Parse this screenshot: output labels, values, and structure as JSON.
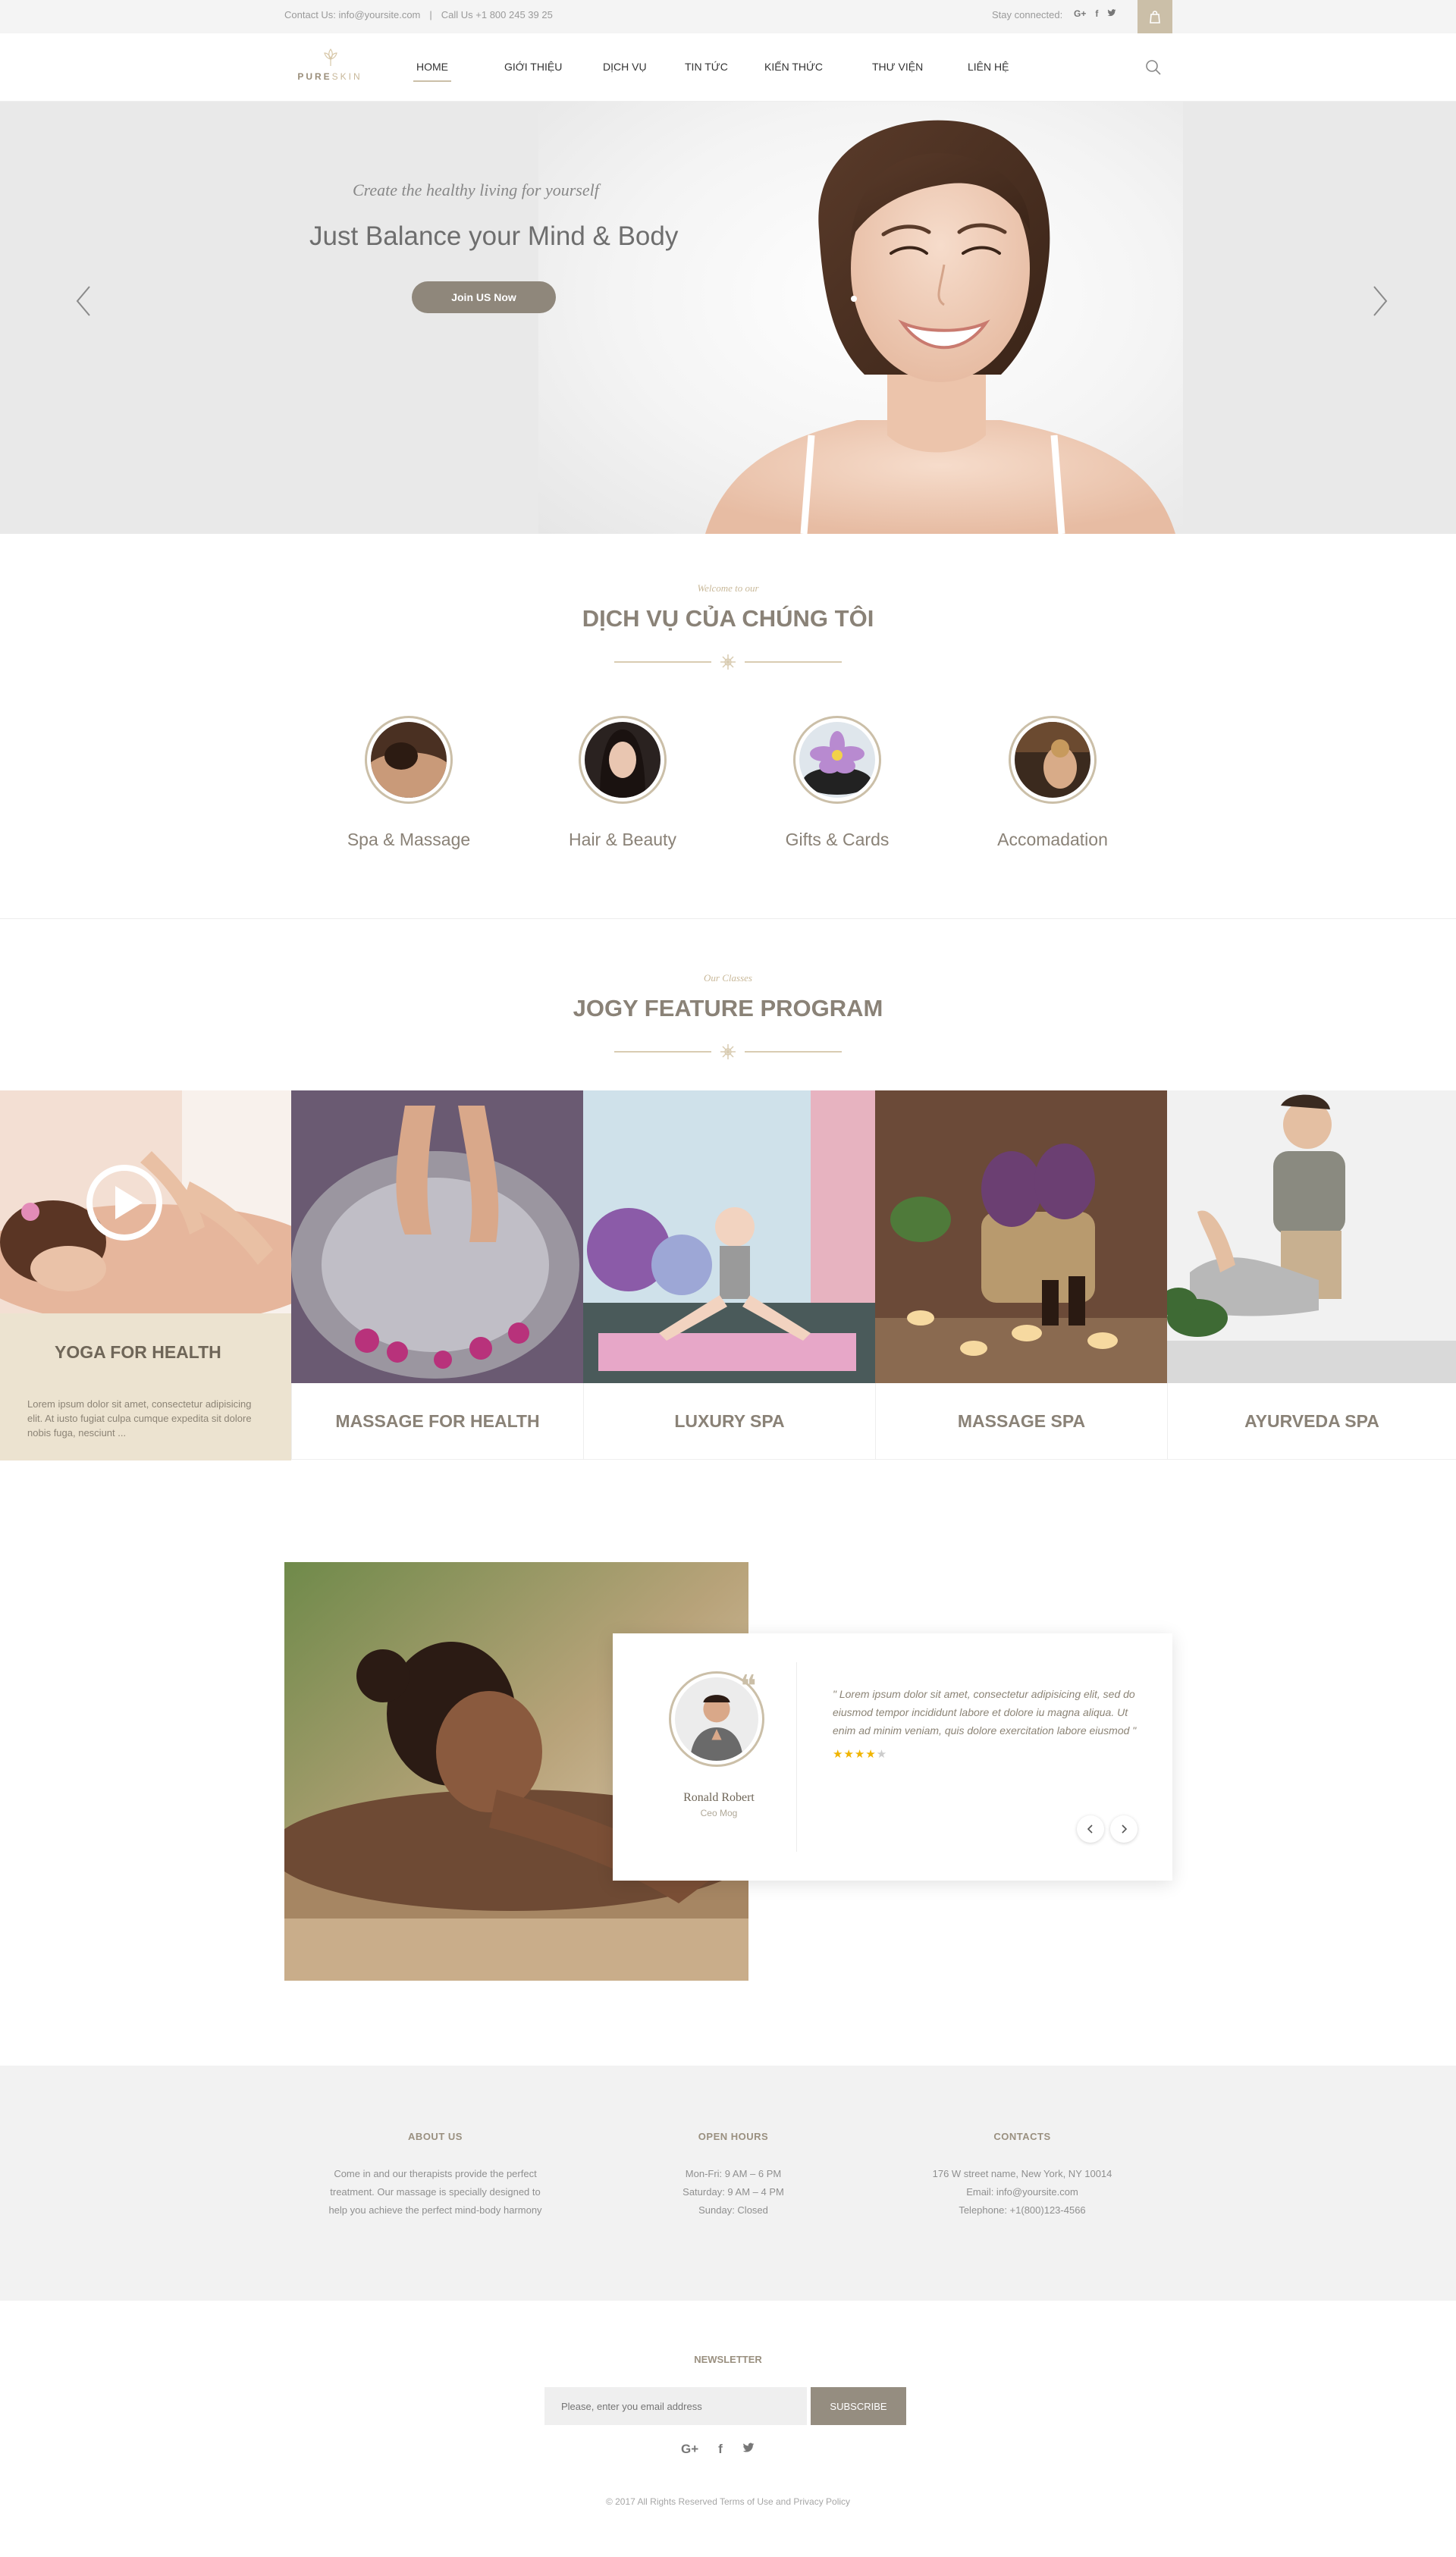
{
  "topbar": {
    "contact": "Contact Us: info@yoursite.com",
    "call": "Call Us +1 800 245 39 25",
    "stay_connected": "Stay connected:",
    "social_icons": [
      "google-plus-icon",
      "facebook-icon",
      "twitter-icon"
    ],
    "cart_icon": "bag-icon"
  },
  "logo": {
    "brand_a": "PURE",
    "brand_b": "SKIN"
  },
  "nav": {
    "items": [
      {
        "label": "HOME",
        "active": true
      },
      {
        "label": "GIỚI THIỆU"
      },
      {
        "label": "DỊCH VỤ"
      },
      {
        "label": "TIN TỨC"
      },
      {
        "label": "KIẾN THỨC"
      },
      {
        "label": "THƯ VIỆN"
      },
      {
        "label": "LIÊN HỆ"
      }
    ],
    "search_icon": "search-icon"
  },
  "hero": {
    "tagline": "Create the healthy living for yourself",
    "title": "Just Balance your Mind & Body",
    "button": "Join US Now"
  },
  "services": {
    "subtitle": "Welcome to our",
    "title": "DỊCH VỤ CỦA CHÚNG TÔI",
    "items": [
      {
        "label": "Spa & Massage"
      },
      {
        "label": "Hair & Beauty"
      },
      {
        "label": "Gifts & Cards"
      },
      {
        "label": "Accomadation"
      }
    ]
  },
  "programs": {
    "subtitle": "Our Classes",
    "title": "JOGY FEATURE PROGRAM",
    "featured": {
      "title": "YOGA FOR HEALTH",
      "text": "Lorem ipsum dolor sit amet, consectetur adipisicing elit. At iusto fugiat culpa cumque expedita sit dolore nobis fuga, nesciunt ..."
    },
    "items": [
      {
        "label": "MASSAGE FOR HEALTH"
      },
      {
        "label": "LUXURY SPA"
      },
      {
        "label": "MASSAGE SPA"
      },
      {
        "label": "AYURVEDA SPA"
      }
    ]
  },
  "testimonial": {
    "quote": "\" Lorem ipsum dolor sit amet, consectetur adipisicing elit, sed do eiusmod tempor incididunt labore et dolore iu magna aliqua. Ut enim ad minim veniam, quis dolore exercitation labore eiusmod \"",
    "rating": 4,
    "max_rating": 5,
    "name": "Ronald Robert",
    "role": "Ceo Mog"
  },
  "footer": {
    "about": {
      "heading": "ABOUT US",
      "lines": [
        "Come in and our therapists provide the perfect",
        "treatment. Our massage is specially designed to",
        "help you achieve the perfect mind-body harmony"
      ]
    },
    "hours": {
      "heading": "OPEN HOURS",
      "lines": [
        "Mon-Fri: 9 AM – 6 PM",
        "Saturday: 9 AM – 4 PM",
        "Sunday: Closed"
      ]
    },
    "contacts": {
      "heading": "CONTACTS",
      "lines": [
        "176 W street name, New York, NY 10014",
        "Email: info@yoursite.com",
        "Telephone: +1(800)123-4566"
      ]
    }
  },
  "newsletter": {
    "title": "NEWSLETTER",
    "placeholder": "Please, enter you email address",
    "button": "SUBSCRIBE"
  },
  "copyright": "© 2017 All Rights Reserved Terms of Use and Privacy Policy",
  "colors": {
    "accent": "#cbbfa8",
    "heading": "#8a8277",
    "button": "#8f877b",
    "panel": "#ece3d0"
  }
}
